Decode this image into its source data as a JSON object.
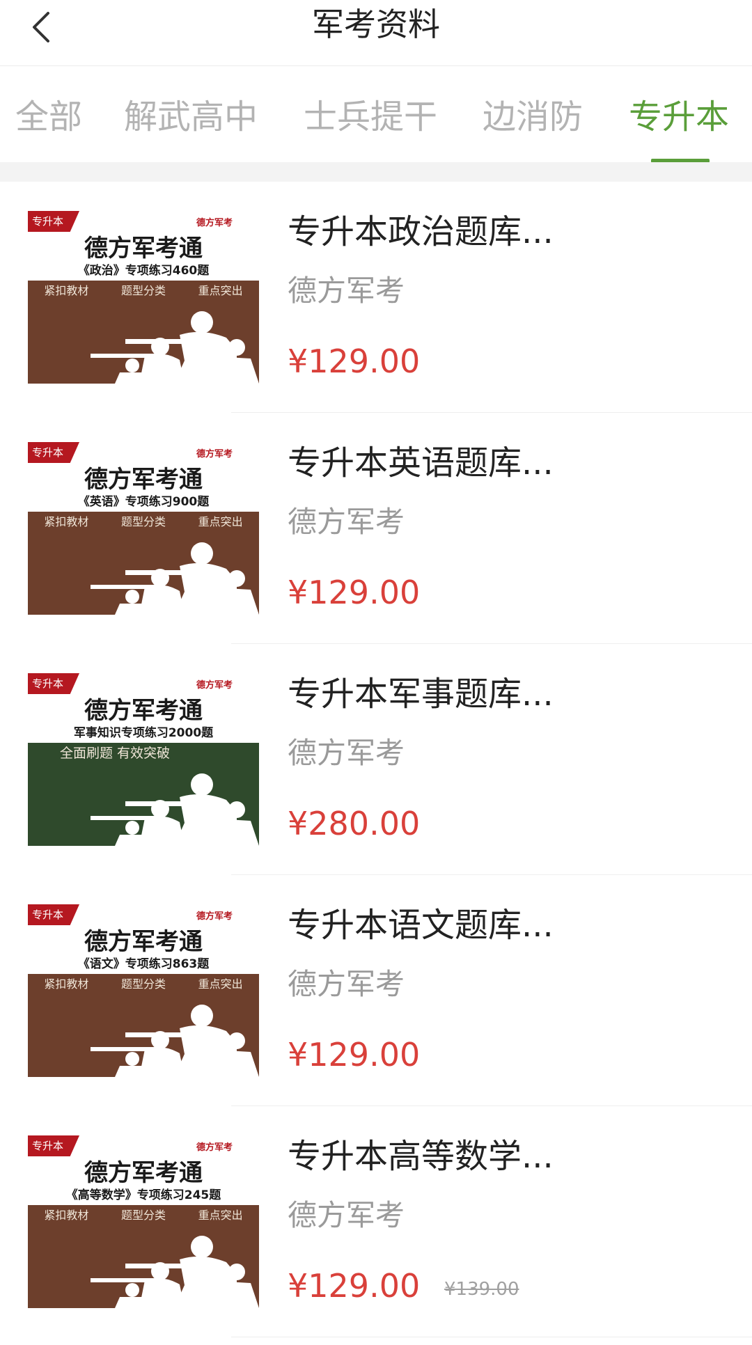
{
  "header": {
    "title": "军考资料",
    "back_icon": "chevron-left-icon"
  },
  "tabs": [
    {
      "label": "全部",
      "active": false
    },
    {
      "label": "解武高中",
      "active": false
    },
    {
      "label": "士兵提干",
      "active": false
    },
    {
      "label": "边消防",
      "active": false
    },
    {
      "label": "专升本",
      "active": true
    }
  ],
  "colors": {
    "accent": "#5a9e3a",
    "price": "#d9403a",
    "muted": "#9a9a9a"
  },
  "items": [
    {
      "title": "专升本政治题库...",
      "author": "德方军考",
      "price": "¥129.00",
      "old_price": "",
      "cover": {
        "tag": "专升本",
        "brand": "德方军考",
        "title": "德方军考通",
        "subtitle": "《政治》专项练习460题",
        "features": [
          "紧扣教材",
          "题型分类",
          "重点突出"
        ],
        "bg": "#6d3f2c"
      }
    },
    {
      "title": "专升本英语题库...",
      "author": "德方军考",
      "price": "¥129.00",
      "old_price": "",
      "cover": {
        "tag": "专升本",
        "brand": "德方军考",
        "title": "德方军考通",
        "subtitle": "《英语》专项练习900题",
        "features": [
          "紧扣教材",
          "题型分类",
          "重点突出"
        ],
        "bg": "#6d3f2c"
      }
    },
    {
      "title": "专升本军事题库...",
      "author": "德方军考",
      "price": "¥280.00",
      "old_price": "",
      "cover": {
        "tag": "专升本",
        "brand": "德方军考",
        "title": "德方军考通",
        "subtitle": "军事知识专项练习2000题",
        "features": [
          "全面刷题 有效突破"
        ],
        "bg": "#2f4a2c"
      }
    },
    {
      "title": "专升本语文题库...",
      "author": "德方军考",
      "price": "¥129.00",
      "old_price": "",
      "cover": {
        "tag": "专升本",
        "brand": "德方军考",
        "title": "德方军考通",
        "subtitle": "《语文》专项练习863题",
        "features": [
          "紧扣教材",
          "题型分类",
          "重点突出"
        ],
        "bg": "#6d3f2c"
      }
    },
    {
      "title": "专升本高等数学...",
      "author": "德方军考",
      "price": "¥129.00",
      "old_price": "¥139.00",
      "cover": {
        "tag": "专升本",
        "brand": "德方军考",
        "title": "德方军考通",
        "subtitle": "《高等数学》专项练习245题",
        "features": [
          "紧扣教材",
          "题型分类",
          "重点突出"
        ],
        "bg": "#6d3f2c"
      }
    }
  ]
}
